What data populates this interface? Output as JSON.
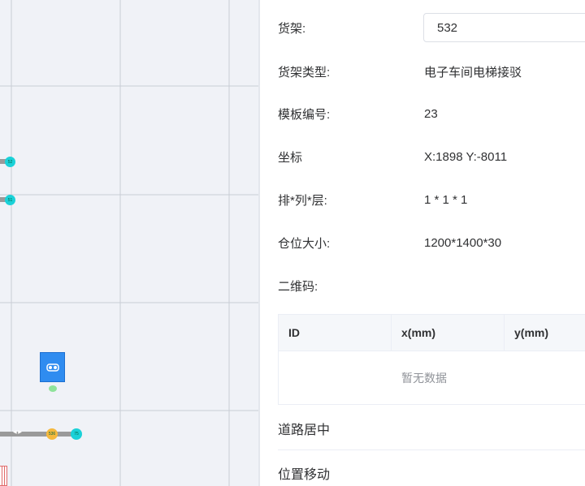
{
  "map": {
    "nodes": [
      {
        "label": "52",
        "color": "#1ad1d8"
      },
      {
        "label": "51",
        "color": "#1ad1d8"
      },
      {
        "label": "536",
        "color": "#f5b83d"
      },
      {
        "label": "75",
        "color": "#1ad1d8"
      }
    ],
    "track_arrows": "◀ ▶"
  },
  "detail": {
    "shelf_label": "货架:",
    "shelf_value": "532",
    "type_label": "货架类型:",
    "type_value": "电子车间电梯接驳",
    "template_label": "模板编号:",
    "template_value": "23",
    "coord_label": "坐标",
    "coord_value": "X:1898 Y:-8011",
    "layout_label": "排*列*层:",
    "layout_value": "1 * 1 * 1",
    "size_label": "仓位大小:",
    "size_value": "1200*1400*30",
    "qr_label": "二维码:"
  },
  "table": {
    "columns": [
      "ID",
      "x(mm)",
      "y(mm)"
    ],
    "empty_text": "暂无数据"
  },
  "sections": {
    "road_center": "道路居中",
    "position_move": "位置移动"
  }
}
